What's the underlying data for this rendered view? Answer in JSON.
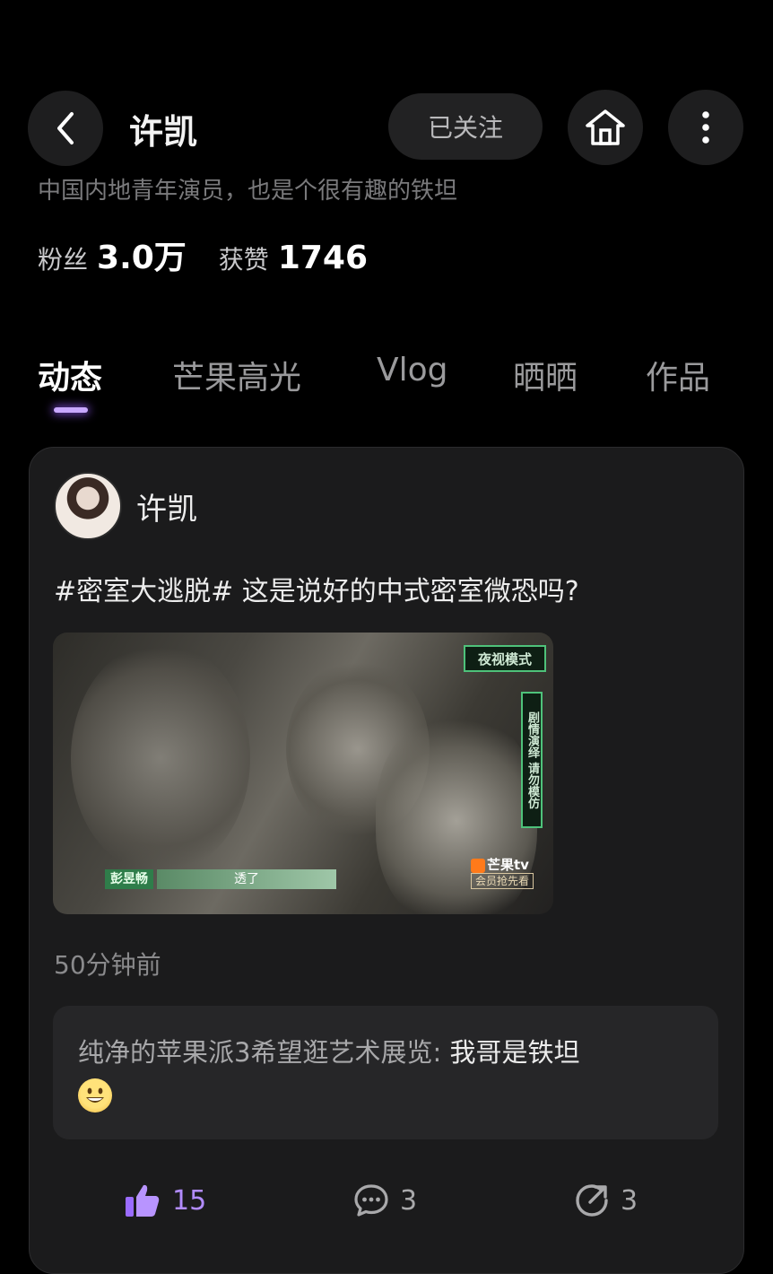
{
  "header": {
    "back_icon": "chevron-left-icon",
    "title": "许凯",
    "follow_label": "已关注",
    "home_icon": "home-icon",
    "more_icon": "more-vertical-icon"
  },
  "profile": {
    "bio": "中国内地青年演员，也是个很有趣的铁坦",
    "fans_label": "粉丝",
    "fans_value": "3.0万",
    "likes_label": "获赞",
    "likes_value": "1746"
  },
  "tabs": [
    {
      "label": "动态",
      "active": true
    },
    {
      "label": "芒果高光",
      "active": false
    },
    {
      "label": "Vlog",
      "active": false
    },
    {
      "label": "晒晒",
      "active": false
    },
    {
      "label": "作品",
      "active": false
    }
  ],
  "post": {
    "author": "许凯",
    "text": "#密室大逃脱# 这是说好的中式密室微恐吗?",
    "video": {
      "night_tag": "夜视模式",
      "vertical_tag": "剧情演绎 请勿模仿",
      "subtitle_name": "彭昱畅",
      "subtitle_text": "透了",
      "logo": "芒果tv",
      "logo_sub": "会员抢先看"
    },
    "time": "50分钟前",
    "comment": {
      "user": "纯净的苹果派3希望逛艺术展览:",
      "body": "我哥是铁坦",
      "emoji": "grinning-face-emoji"
    },
    "actions": {
      "like_count": "15",
      "comment_count": "3",
      "share_count": "3"
    }
  },
  "colors": {
    "background": "#000000",
    "card": "#1b1b1c",
    "accent_purple": "#b28cff",
    "tab_indicator": "#c8a8ff"
  }
}
